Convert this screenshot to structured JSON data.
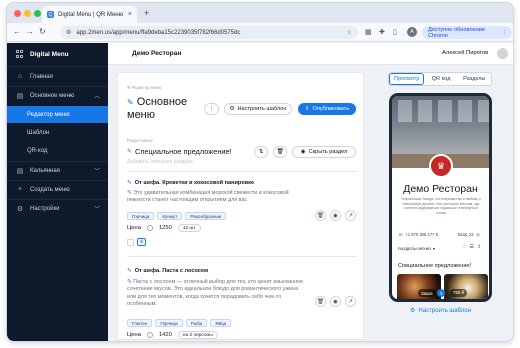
{
  "browser": {
    "tab_title": "Digital Menu | QR Меню",
    "tab_favicon": "Q",
    "new_tab": "+",
    "url": "app.2men.us/app/menu/ffa9deba15c2239035f782f66d0575dc",
    "update_button": "Доступно обновление Chrome",
    "profile_letter": "A"
  },
  "sidebar": {
    "brand": "Digital Menu",
    "items": [
      {
        "label": "Главная",
        "icon": "home-icon"
      },
      {
        "label": "Основное меню",
        "icon": "book-icon"
      },
      {
        "label": "Редактор меню"
      },
      {
        "label": "Шаблон"
      },
      {
        "label": "QR-код"
      },
      {
        "label": "Кальянная",
        "icon": "book-icon"
      },
      {
        "label": "Создать меню",
        "icon": "plus-icon"
      },
      {
        "label": "Настройки",
        "icon": "gear-icon"
      }
    ]
  },
  "header": {
    "title": "Демо Ресторан",
    "user": "Алексей Пирогов"
  },
  "editor": {
    "menu_label": "Редактор меню",
    "menu_title": "Основное меню",
    "more_button": "⋮",
    "template_button": "Настроить шаблон",
    "publish_button": "Опубликовать",
    "section_label": "Раздел меню",
    "section_title": "Специальное предложение!",
    "section_desc_placeholder": "Добавить описание раздела",
    "hide_section_button": "Скрыть раздел",
    "dishes": [
      {
        "title": "От шефа. Креветки в кокосовой панировке",
        "desc": "Это удивительная комбинация морской свежести и кокосовой нежности станет настоящим открытием для вас",
        "tags": [
          "Горчица",
          "Кунжут",
          "Ракообразные"
        ],
        "price_label": "Цена",
        "price": "1250",
        "unit": "12 шт."
      },
      {
        "title": "От шефа. Паста с лососем",
        "desc": "Паста с лососем — отличный выбор для тех, кто ценит изысканное сочетание вкусов. Это идеальное блюдо для романтического ужина или для тех моментов, когда хочется порадовать себя чем-то особенным.",
        "tags": [
          "Глютен",
          "Горчица",
          "Рыба",
          "Яйца"
        ],
        "price_label": "Цена",
        "price": "1420",
        "unit": "на 2 персоны"
      }
    ]
  },
  "preview": {
    "tabs": [
      "Просмотр",
      "QR код",
      "Разделы"
    ],
    "restaurant_name": "Демо Ресторан",
    "restaurant_desc": "Уникальные блюда, гостеприимство и любовь к атмосфере делают этот ресторан местом, где хочется задержаться подольше и вернуться снова",
    "phone": "+1 670 306 177 5",
    "meta": "Вход 23",
    "sections_label": "РАЗДЕЛЫ МЕНЮ",
    "section_heading": "Специальное предложение!",
    "badge_order": "Заказ",
    "badge_count": "3",
    "badge_price": "750 ₽",
    "setup_link": "Настроить шаблон"
  }
}
